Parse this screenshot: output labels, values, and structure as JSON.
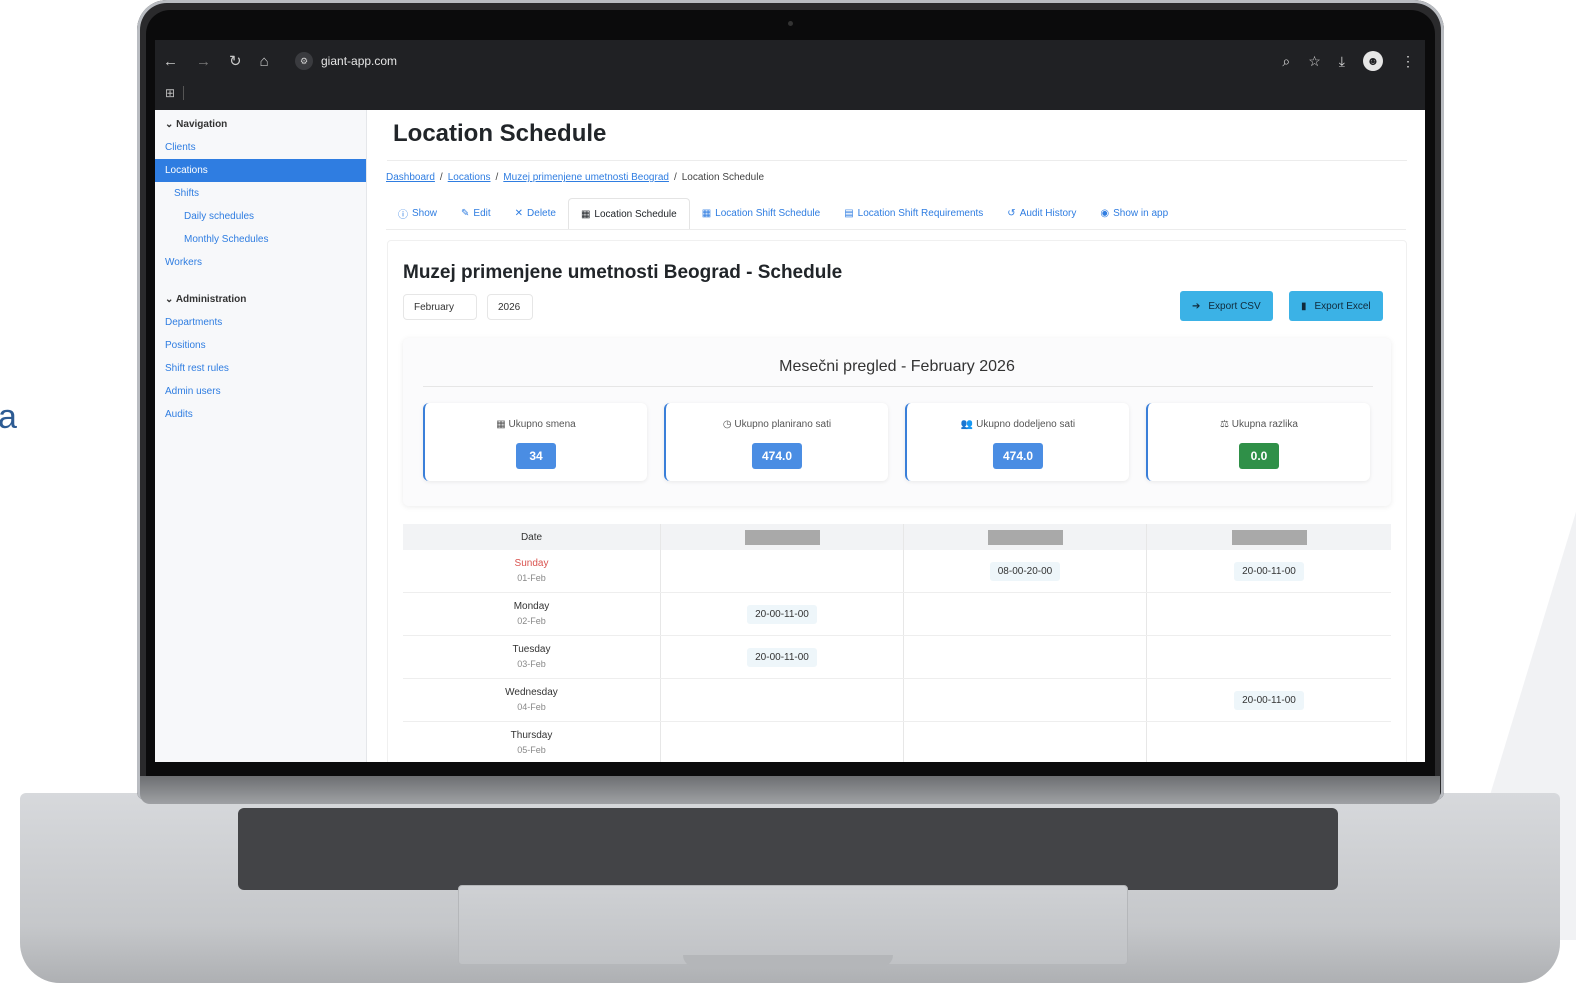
{
  "backdrop": {
    "side_letter": "a"
  },
  "browser": {
    "url": "giant-app.com",
    "nav_icons": [
      "back-arrow",
      "forward-arrow",
      "reload",
      "home"
    ]
  },
  "sidebar": {
    "navigation_label": "Navigation",
    "nav_items": [
      {
        "label": "Clients",
        "level": 0,
        "active": false
      },
      {
        "label": "Locations",
        "level": 0,
        "active": true
      },
      {
        "label": "Shifts",
        "level": 1,
        "active": false
      },
      {
        "label": "Daily schedules",
        "level": 2,
        "active": false
      },
      {
        "label": "Monthly Schedules",
        "level": 2,
        "active": false
      },
      {
        "label": "Workers",
        "level": 0,
        "active": false
      }
    ],
    "administration_label": "Administration",
    "admin_items": [
      "Departments",
      "Positions",
      "Shift rest rules",
      "Admin users",
      "Audits"
    ]
  },
  "page": {
    "title": "Location Schedule",
    "breadcrumb": [
      "Dashboard",
      "Locations",
      "Muzej primenjene umetnosti Beograd",
      "Location Schedule"
    ],
    "tabs": [
      {
        "label": "Show",
        "icon": "info-icon",
        "glyph": "ⓘ",
        "active": false
      },
      {
        "label": "Edit",
        "icon": "pencil-icon",
        "glyph": "✎",
        "active": false
      },
      {
        "label": "Delete",
        "icon": "close-icon",
        "glyph": "✕",
        "active": false
      },
      {
        "label": "Location Schedule",
        "icon": "calendar-icon",
        "glyph": "▦",
        "active": true
      },
      {
        "label": "Location Shift Schedule",
        "icon": "calendar-grid-icon",
        "glyph": "▦",
        "active": false
      },
      {
        "label": "Location Shift Requirements",
        "icon": "clipboard-icon",
        "glyph": "▤",
        "active": false
      },
      {
        "label": "Audit History",
        "icon": "history-icon",
        "glyph": "↺",
        "active": false
      },
      {
        "label": "Show in app",
        "icon": "eye-icon",
        "glyph": "◉",
        "active": false
      }
    ]
  },
  "schedule": {
    "title": "Muzej primenjene umetnosti Beograd - Schedule",
    "month": "February",
    "year": "2026",
    "export_csv": "Export CSV",
    "export_excel": "Export Excel",
    "summary_title": "Mesečni pregled - February 2026",
    "stats": [
      {
        "label": "Ukupno smena",
        "value": "34",
        "icon": "calendar-icon",
        "glyph": "▦",
        "color": "#4a8de3"
      },
      {
        "label": "Ukupno planirano sati",
        "value": "474.0",
        "icon": "clock-icon",
        "glyph": "◷",
        "color": "#4a8de3"
      },
      {
        "label": "Ukupno dodeljeno sati",
        "value": "474.0",
        "icon": "users-icon",
        "glyph": "👥",
        "color": "#4a8de3"
      },
      {
        "label": "Ukupna razlika",
        "value": "0.0",
        "icon": "balance-icon",
        "glyph": "⚖",
        "color": "#2f9048"
      }
    ],
    "table_header": "Date",
    "rows": [
      {
        "day": "Sunday",
        "date": "01-Feb",
        "weekend": true,
        "cells": [
          "",
          "08-00-20-00",
          "20-00-11-00"
        ]
      },
      {
        "day": "Monday",
        "date": "02-Feb",
        "weekend": false,
        "cells": [
          "20-00-11-00",
          "",
          ""
        ]
      },
      {
        "day": "Tuesday",
        "date": "03-Feb",
        "weekend": false,
        "cells": [
          "20-00-11-00",
          "",
          ""
        ]
      },
      {
        "day": "Wednesday",
        "date": "04-Feb",
        "weekend": false,
        "cells": [
          "",
          "",
          "20-00-11-00"
        ]
      },
      {
        "day": "Thursday",
        "date": "05-Feb",
        "weekend": false,
        "cells": [
          "",
          "",
          ""
        ]
      }
    ]
  },
  "colors": {
    "accent": "#2f7de1",
    "export_button": "#3bb2e6",
    "stat_blue": "#4a8de3",
    "stat_green": "#2f9048",
    "sunday": "#d9534f"
  }
}
